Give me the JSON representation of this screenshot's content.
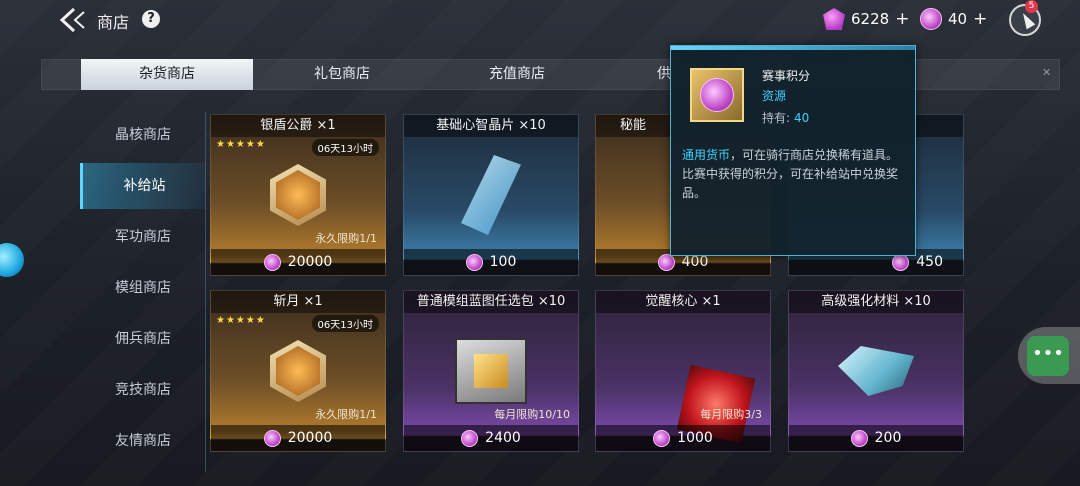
{
  "header": {
    "title": "商店",
    "help": "?",
    "currencies": [
      {
        "icon": "gem-icon",
        "value": "6228",
        "plus": "+"
      },
      {
        "icon": "race-coin-icon",
        "value": "40",
        "plus": "+"
      }
    ],
    "compass_badge": "5"
  },
  "tabs": [
    "杂货商店",
    "礼包商店",
    "充值商店",
    "供"
  ],
  "sidebar": [
    "晶核商店",
    "补给站",
    "军功商店",
    "模组商店",
    "佣兵商店",
    "竞技商店",
    "友情商店"
  ],
  "cards": [
    {
      "name": "银盾公爵 ×1",
      "stars": "★★★★★",
      "timer": "06天13小时",
      "limit": "永久限购1/1",
      "price": "20000"
    },
    {
      "name": "基础心智晶片 ×10",
      "price": "100"
    },
    {
      "name": "秘能",
      "price": "400"
    },
    {
      "name": "",
      "price": "450"
    },
    {
      "name": "斩月 ×1",
      "stars": "★★★★★",
      "timer": "06天13小时",
      "limit": "永久限购1/1",
      "price": "20000"
    },
    {
      "name": "普通模组蓝图任选包 ×10",
      "limit": "每月限购10/10",
      "price": "2400"
    },
    {
      "name": "觉醒核心 ×1",
      "limit": "每月限购3/3",
      "price": "1000"
    },
    {
      "name": "高级强化材料 ×10",
      "price": "200"
    }
  ],
  "tooltip": {
    "name": "赛事积分",
    "type": "资源",
    "own_label": "持有:",
    "own_value": "40",
    "desc_highlight": "通用货币",
    "desc_rest": "，可在骑行商店兑换稀有道具。比赛中获得的积分，可在补给站中兑换奖品。"
  },
  "colors": {
    "accent": "#3fd0ff",
    "active_tab_bg": "#e6ebf0",
    "coin": "#c04bc9"
  }
}
